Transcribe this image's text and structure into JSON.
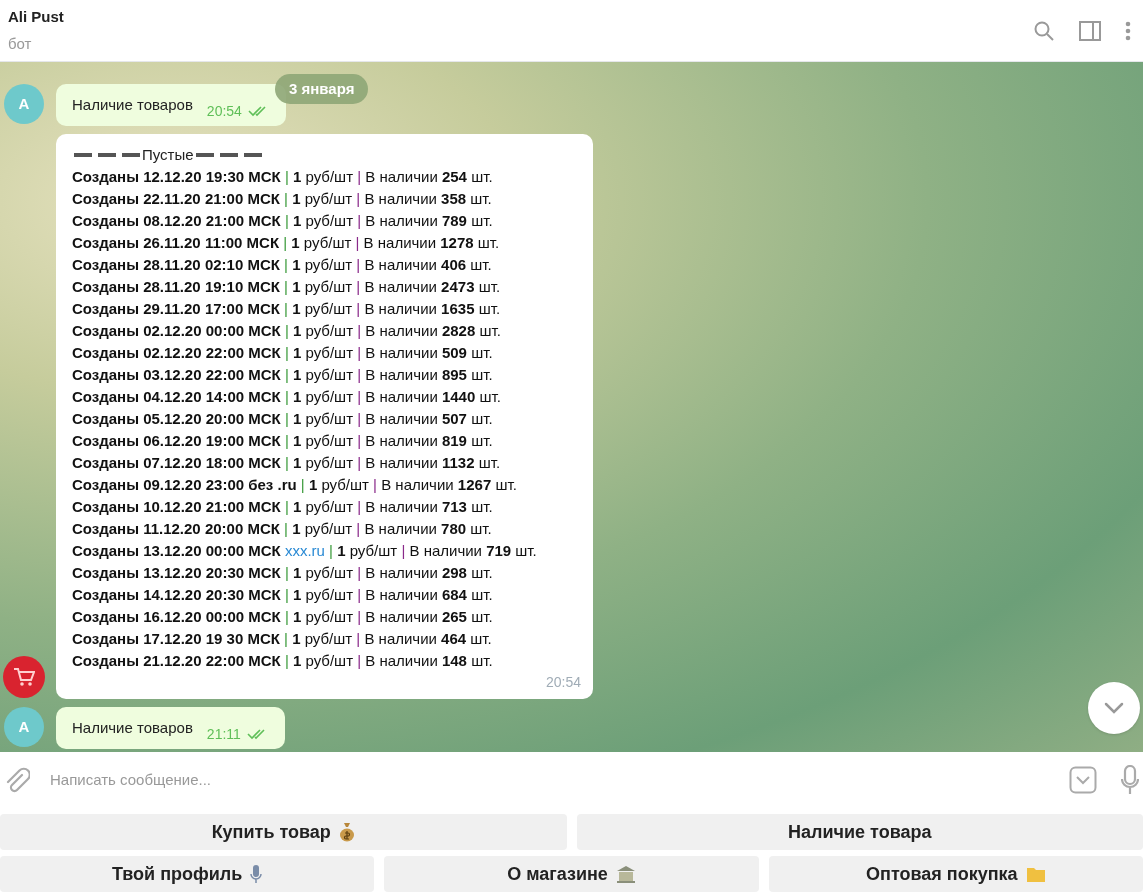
{
  "header": {
    "title": "Ali Pust",
    "subtitle": "бот"
  },
  "date_badge": "3 января",
  "messages": [
    {
      "kind": "outgoing",
      "avatar_letter": "A",
      "text": "Наличие товаров",
      "time": "20:54",
      "read": true
    },
    {
      "kind": "report",
      "heading": "Пустые",
      "separator": "|",
      "time": "20:54",
      "lines": [
        {
          "segments": [
            "**Созданы 12.12.20 19:30 МСК**",
            "**1** руб/шт",
            "В наличии **254** шт."
          ]
        },
        {
          "segments": [
            "**Созданы 22.11.20 21:00 МСК**",
            "**1** руб/шт",
            "В наличии **358** шт."
          ]
        },
        {
          "segments": [
            "**Созданы 08.12.20 21:00 МСК**",
            "**1** руб/шт",
            "В наличии **789** шт."
          ]
        },
        {
          "segments": [
            "**Созданы 26.11.20 11:00 МСК**",
            "**1** руб/шт",
            "В наличии **1278** шт."
          ]
        },
        {
          "segments": [
            "**Созданы 28.11.20 02:10 МСК**",
            "**1** руб/шт",
            "В наличии **406** шт."
          ]
        },
        {
          "segments": [
            "**Созданы 28.11.20 19:10 МСК**",
            "**1** руб/шт",
            "В наличии **2473** шт."
          ]
        },
        {
          "segments": [
            "**Созданы 29.11.20 17:00 МСК**",
            "**1** руб/шт",
            "В наличии **1635** шт."
          ]
        },
        {
          "segments": [
            "**Созданы 02.12.20 00:00 МСК**",
            "**1** руб/шт",
            "В наличии **2828** шт."
          ]
        },
        {
          "segments": [
            "**Созданы 02.12.20 22:00 МСК**",
            "**1** руб/шт",
            "В наличии **509** шт."
          ]
        },
        {
          "segments": [
            "**Созданы 03.12.20 22:00 МСК**",
            "**1** руб/шт",
            "В наличии **895** шт."
          ]
        },
        {
          "segments": [
            "**Созданы 04.12.20 14:00 МСК**",
            "**1** руб/шт",
            "В наличии **1440** шт."
          ]
        },
        {
          "segments": [
            "**Созданы 05.12.20 20:00 МСК**",
            "**1** руб/шт",
            "В наличии **507** шт."
          ]
        },
        {
          "segments": [
            "**Созданы 06.12.20 19:00 МСК**",
            "**1** руб/шт",
            "В наличии **819** шт."
          ]
        },
        {
          "segments": [
            "**Созданы 07.12.20 18:00 МСК**",
            "**1** руб/шт",
            "В наличии **1132** шт."
          ]
        },
        {
          "segments": [
            "**Созданы 09.12.20 23:00 без .ru**",
            "**1** руб/шт",
            "В наличии **1267** шт."
          ]
        },
        {
          "segments": [
            "**Созданы 10.12.20 21:00 МСК**",
            "**1** руб/шт",
            "В наличии **713** шт."
          ]
        },
        {
          "segments": [
            "**Созданы 11.12.20 20:00 МСК**",
            "**1** руб/шт",
            "В наличии **780** шт."
          ]
        },
        {
          "segments": [
            "**Созданы 13.12.20 00:00 МСК**",
            "**1** руб/шт",
            "В наличии **719** шт."
          ],
          "link": "xxx.ru"
        },
        {
          "segments": [
            "**Созданы 13.12.20 20:30 МСК**",
            "**1** руб/шт",
            "В наличии **298** шт."
          ]
        },
        {
          "segments": [
            "**Созданы 14.12.20 20:30 МСК**",
            "**1** руб/шт",
            "В наличии **684** шт."
          ]
        },
        {
          "segments": [
            "**Созданы 16.12.20 00:00 МСК**",
            "**1** руб/шт",
            "В наличии **265** шт."
          ]
        },
        {
          "segments": [
            "**Созданы 17.12.20 19 30 МСК**",
            "**1** руб/шт",
            "В наличии **464** шт."
          ]
        },
        {
          "segments": [
            "**Созданы 21.12.20 22:00 МСК**",
            "**1** руб/шт",
            "В наличии **148** шт."
          ]
        }
      ]
    },
    {
      "kind": "outgoing",
      "avatar_letter": "A",
      "text": "Наличие товаров",
      "time": "21:11",
      "read": true
    }
  ],
  "composer": {
    "placeholder": "Написать сообщение..."
  },
  "keyboard": [
    [
      {
        "label": "Купить товар",
        "kind": "with-emoji"
      },
      {
        "label": "Наличие товара",
        "kind": "plain"
      }
    ],
    [
      {
        "label": "Твой профиль",
        "kind": "with-emoji"
      },
      {
        "label": "О магазине",
        "kind": "with-emoji"
      },
      {
        "label": "Оптовая покупка",
        "kind": "with-emoji"
      }
    ]
  ]
}
